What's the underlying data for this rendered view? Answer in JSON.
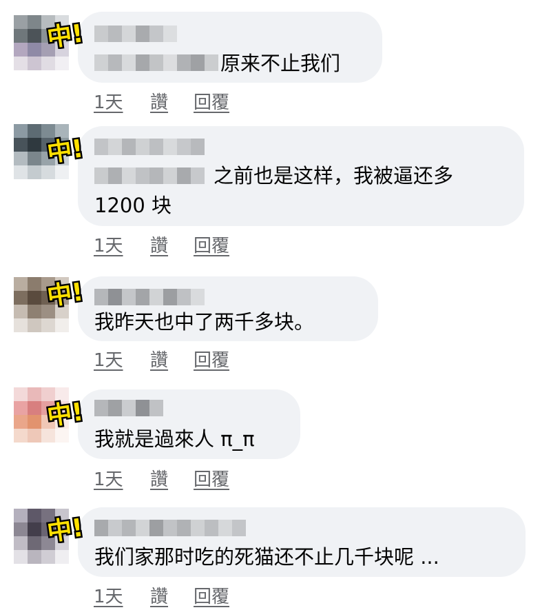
{
  "badge_text": "中!",
  "actions": {
    "day": "1天",
    "like": "讚",
    "reply": "回覆"
  },
  "comments": [
    {
      "line1": "原来不止我们",
      "line2": ""
    },
    {
      "line1": "之前也是这样，我被逼还多",
      "line2": "1200 块"
    },
    {
      "line1": "我昨天也中了两千多块。",
      "line2": ""
    },
    {
      "line1": "我就是過來人 π_π",
      "line2": ""
    },
    {
      "line1": "我们家那时吃的死猫还不止几千块呢 ...",
      "line2": ""
    }
  ]
}
